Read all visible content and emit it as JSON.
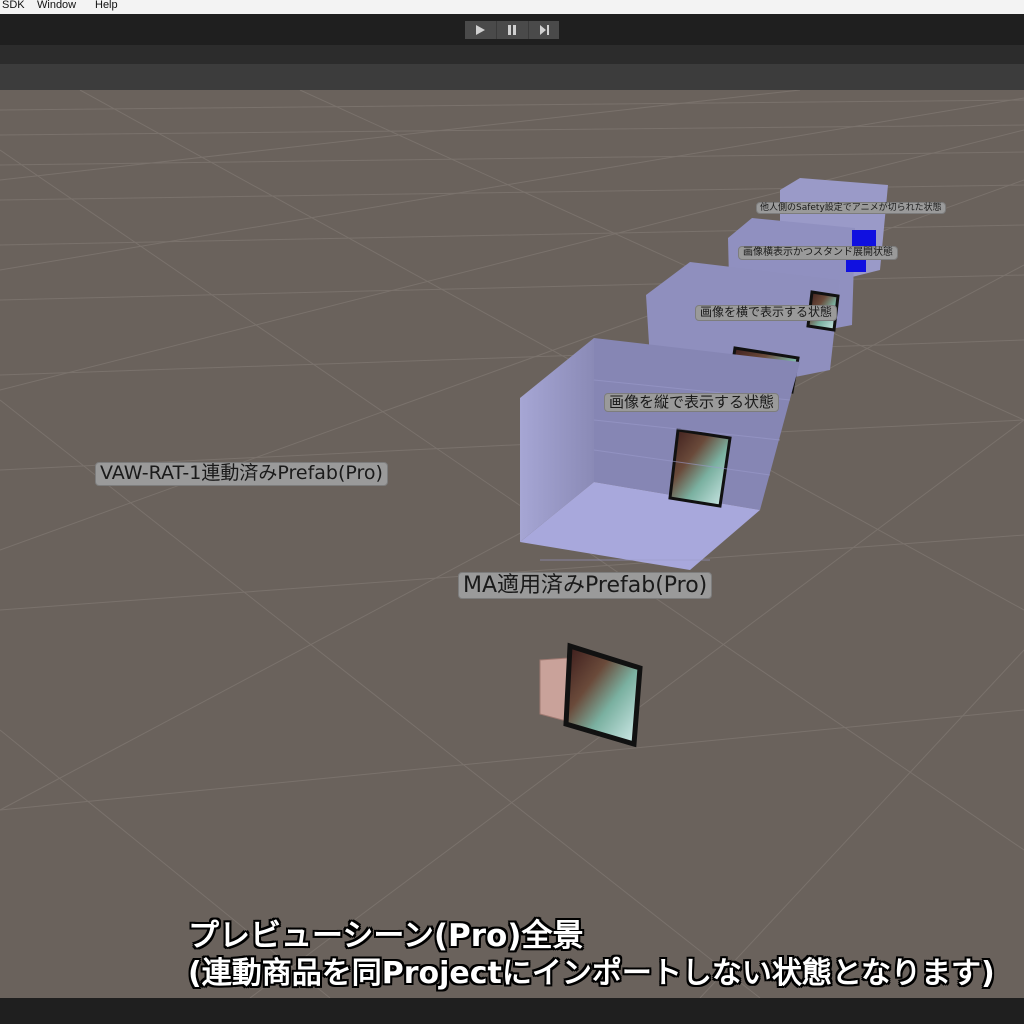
{
  "menu": {
    "items": [
      "SDK",
      "Window",
      "Help"
    ]
  },
  "toolbar": {
    "play_icon": "play-icon",
    "pause_icon": "pause-icon",
    "step_icon": "step-icon"
  },
  "scene": {
    "labels": {
      "vaw": "VAW-RAT-1連動済みPrefab(Pro)",
      "ma": "MA適用済みPrefab(Pro)",
      "vertical": "画像を縦で表示する状態",
      "horizontal": "画像を横で表示する状態",
      "landscape_stand": "画像横表示かつスタンド展開状態",
      "safety": "他人側のSafety設定でアニメが切られた状態"
    }
  },
  "caption": {
    "line1": "プレビューシーン(Pro)全景",
    "line2": "(連動商品を同Projectにインポートしない状態となります)"
  }
}
